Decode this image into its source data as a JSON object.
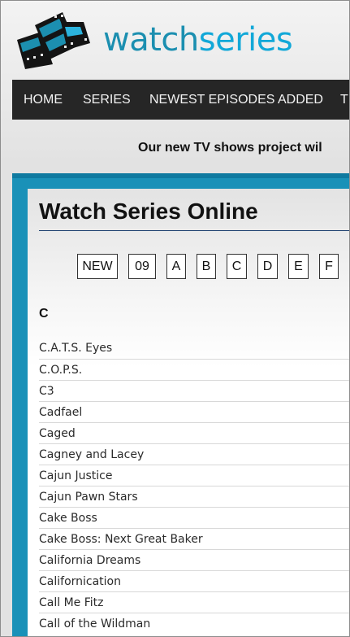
{
  "brand": {
    "part1": "watch",
    "part2": "series"
  },
  "nav": {
    "items": [
      {
        "label": "HOME"
      },
      {
        "label": "SERIES"
      },
      {
        "label": "NEWEST EPISODES ADDED"
      },
      {
        "label": "T"
      }
    ]
  },
  "banner": {
    "text": "Our new TV shows project wil"
  },
  "main": {
    "title": "Watch Series Online",
    "letters": [
      "NEW",
      "09",
      "A",
      "B",
      "C",
      "D",
      "E",
      "F"
    ],
    "section": "C",
    "shows": [
      "C.A.T.S. Eyes",
      "C.O.P.S.",
      "C3",
      "Cadfael",
      "Caged",
      "Cagney and Lacey",
      "Cajun Justice",
      "Cajun Pawn Stars",
      "Cake Boss",
      "Cake Boss: Next Great Baker",
      "California Dreams",
      "Californication",
      "Call Me Fitz",
      "Call of the Wildman"
    ]
  },
  "colors": {
    "brand_primary": "#1c8fb0",
    "brand_secondary": "#12a8d8",
    "nav_bg": "#262626",
    "content_border": "#1a91b8"
  }
}
